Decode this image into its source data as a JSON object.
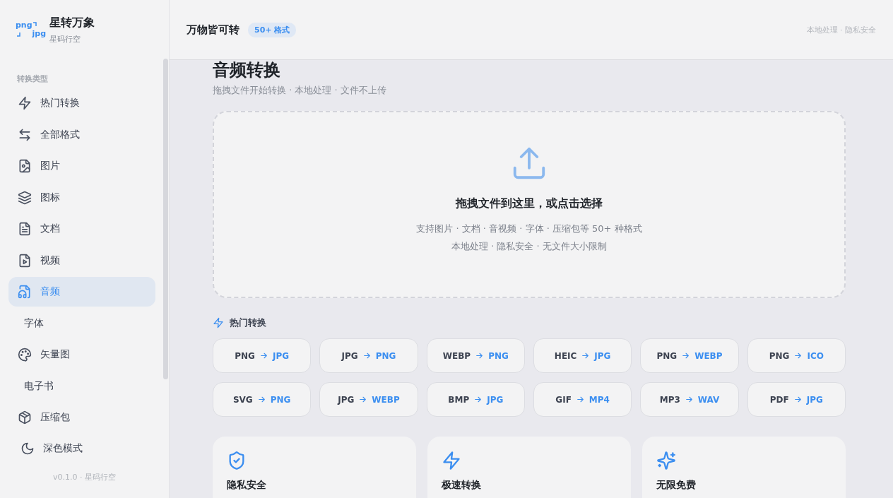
{
  "brand": {
    "logo_top": "png",
    "logo_bottom": "jpg",
    "name": "星转万象",
    "subtitle": "星码行空"
  },
  "sidebar": {
    "section_label": "转换类型",
    "items": [
      {
        "label": "热门转换",
        "kind": "icon",
        "selected": false
      },
      {
        "label": "全部格式",
        "kind": "icon",
        "selected": false
      },
      {
        "label": "图片",
        "kind": "icon",
        "selected": false
      },
      {
        "label": "图标",
        "kind": "icon",
        "selected": false
      },
      {
        "label": "文档",
        "kind": "icon",
        "selected": false
      },
      {
        "label": "视频",
        "kind": "icon",
        "selected": false
      },
      {
        "label": "音频",
        "kind": "icon",
        "selected": true
      },
      {
        "label": "字体",
        "kind": "plain",
        "selected": false
      },
      {
        "label": "矢量图",
        "kind": "icon",
        "selected": false
      },
      {
        "label": "电子书",
        "kind": "plain",
        "selected": false
      },
      {
        "label": "压缩包",
        "kind": "icon",
        "selected": false
      }
    ],
    "theme_toggle": "深色模式",
    "version": "v0.1.0 · 星码行空"
  },
  "header": {
    "title": "万物皆可转",
    "badge": "50+ 格式",
    "right_note": "本地处理 · 隐私安全"
  },
  "page": {
    "title": "音频转换",
    "subtitle": "拖拽文件开始转换 · 本地处理 · 文件不上传"
  },
  "drop_zone": {
    "heading": "拖拽文件到这里，或点击选择",
    "lines": [
      "支持图片 · 文档 · 音视频 · 字体 · 压缩包等 50+ 种格式",
      "本地处理 · 隐私安全 · 无文件大小限制"
    ]
  },
  "popular": {
    "label": "热门转换",
    "conversions": [
      {
        "from": "PNG",
        "to": "JPG"
      },
      {
        "from": "JPG",
        "to": "PNG"
      },
      {
        "from": "WEBP",
        "to": "PNG"
      },
      {
        "from": "HEIC",
        "to": "JPG"
      },
      {
        "from": "PNG",
        "to": "WEBP"
      },
      {
        "from": "PNG",
        "to": "ICO"
      },
      {
        "from": "SVG",
        "to": "PNG"
      },
      {
        "from": "JPG",
        "to": "WEBP"
      },
      {
        "from": "BMP",
        "to": "JPG"
      },
      {
        "from": "GIF",
        "to": "MP4"
      },
      {
        "from": "MP3",
        "to": "WAV"
      },
      {
        "from": "PDF",
        "to": "JPG"
      }
    ]
  },
  "features": [
    {
      "title": "隐私安全"
    },
    {
      "title": "极速转换"
    },
    {
      "title": "无限免费"
    }
  ]
}
